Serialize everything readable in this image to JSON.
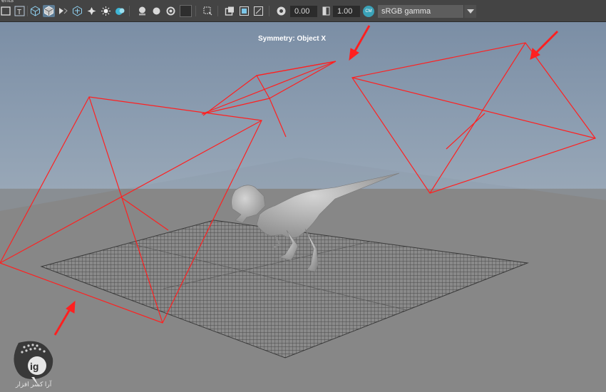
{
  "toolbar": {
    "menu_fragment": "ents",
    "exposure_value": "0.00",
    "gamma_value": "1.00",
    "colorspace_icon_text": "CM",
    "colorspace_value": "sRGB gamma",
    "icons": [
      "grid-icon",
      "text-icon",
      "wireframe-cube-icon",
      "shaded-cube-icon",
      "backface-icon",
      "xray-icon",
      "lights-icon",
      "shadows-icon",
      "ambient-occlusion-icon",
      "motion-blur-icon",
      "antialias-icon",
      "textures-icon",
      "isolate-select-icon",
      "xray-joints-icon",
      "resolution-gate-icon",
      "camera-gate-icon",
      "exposure-icon",
      "gamma-icon",
      "color-management-icon",
      "dropdown-caret-icon"
    ]
  },
  "viewport": {
    "symmetry_label": "Symmetry: Object X",
    "sky_top_color": "#7b8ea5",
    "ground_color": "#858585",
    "frustum_color": "#ff2020",
    "arrow_color": "#ff2020"
  },
  "watermark": {
    "text": "آرا کسر افزار"
  }
}
